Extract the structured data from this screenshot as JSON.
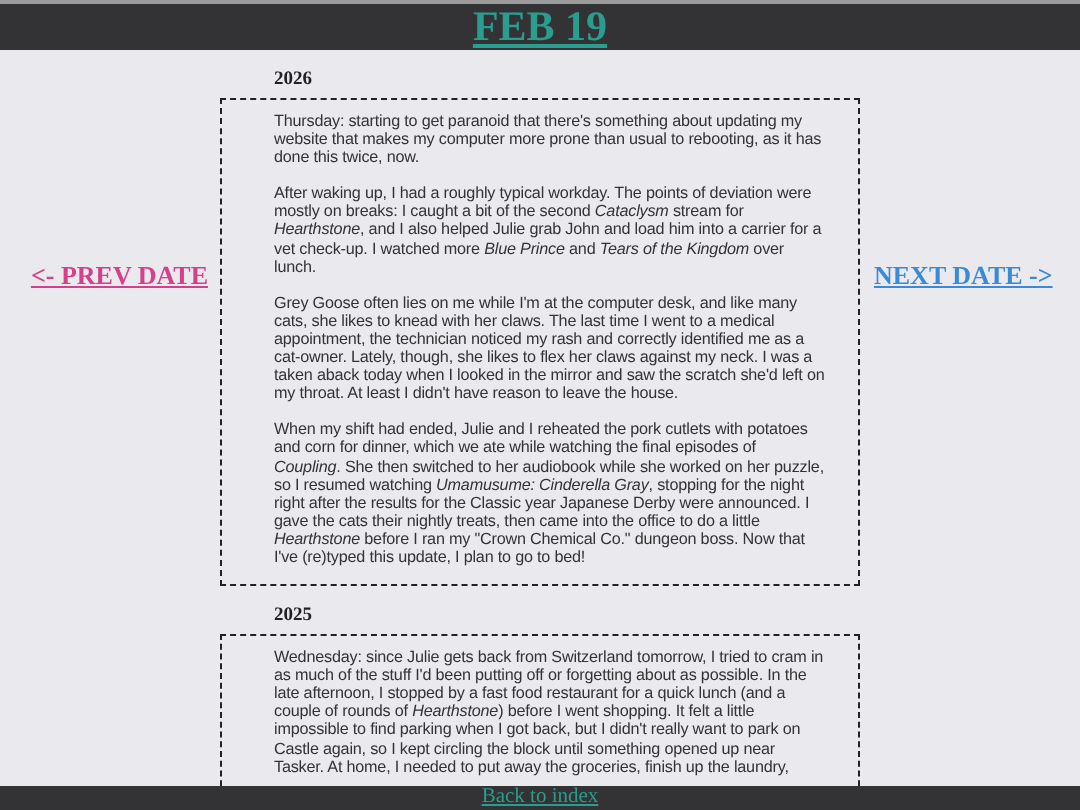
{
  "header": {
    "title": "FEB 19"
  },
  "nav": {
    "prev": "<- PREV DATE",
    "next": "NEXT DATE ->"
  },
  "entries": [
    {
      "year": "2026",
      "paragraphs": [
        "Thursday: starting to get paranoid that there's something about updating my website that makes my computer more prone than usual to rebooting, as it has done this twice, now.",
        "After waking up, I had a roughly typical workday. The points of deviation were mostly on breaks: I caught a bit of the second *Cataclysm* stream for *Hearthstone*, and I also helped Julie grab John and load him into a carrier for a vet check-up. I watched more *Blue Prince* and *Tears of the Kingdom* over lunch.",
        "Grey Goose often lies on me while I'm at the computer desk, and like many cats, she likes to knead with her claws. The last time I went to a medical appointment, the technician noticed my rash and correctly identified me as a cat-owner. Lately, though, she likes to flex her claws against my neck. I was a taken aback today when I looked in the mirror and saw the scratch she'd left on my throat. At least I didn't have reason to leave the house.",
        "When my shift had ended, Julie and I reheated the pork cutlets with potatoes and corn for dinner, which we ate while watching the final episodes of *Coupling*. She then switched to her audiobook while she worked on her puzzle, so I resumed watching *Umamusume: Cinderella Gray*, stopping for the night right after the results for the Classic year Japanese Derby were announced. I gave the cats their nightly treats, then came into the office to do a little *Hearthstone* before I ran my \"Crown Chemical Co.\" dungeon boss. Now that I've (re)typed this update, I plan to go to bed!"
      ]
    },
    {
      "year": "2025",
      "paragraphs": [
        "Wednesday: since Julie gets back from Switzerland tomorrow, I tried to cram in as much of the stuff I'd been putting off or forgetting about as possible. In the late afternoon, I stopped by a fast food restaurant for a quick lunch (and a couple of rounds of *Hearthstone*) before I went shopping. It felt a little impossible to find parking when I got back, but I didn't really want to park on Castle again, so I kept circling the block until something opened up near Tasker. At home, I needed to put away the groceries, finish up the laundry,"
      ]
    }
  ],
  "footer": {
    "link": "Back to index"
  }
}
